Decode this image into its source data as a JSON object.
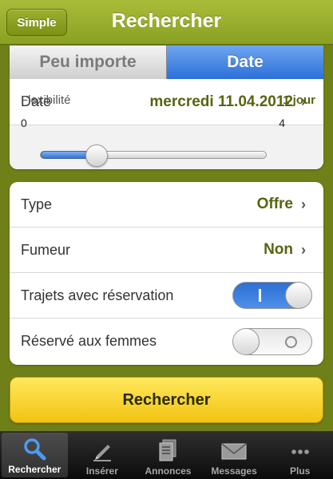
{
  "header": {
    "simple_label": "Simple",
    "title": "Rechercher"
  },
  "segment": {
    "options": [
      "Peu importe",
      "Date"
    ],
    "selected": "Date"
  },
  "date_row": {
    "label": "Date",
    "value": "mercredi 11.04.2012"
  },
  "flexibility": {
    "label": "Flexibilité",
    "value_text": "1 jour",
    "min_label": "0",
    "max_label": "4",
    "min": 0,
    "max": 4,
    "value": 1
  },
  "options": {
    "type": {
      "label": "Type",
      "value": "Offre"
    },
    "smoker": {
      "label": "Fumeur",
      "value": "Non"
    },
    "reservation": {
      "label": "Trajets avec réservation",
      "on": true
    },
    "women": {
      "label": "Réservé aux femmes",
      "on": false
    }
  },
  "search_button": {
    "label": "Rechercher"
  },
  "tabbar": {
    "tabs": [
      {
        "label": "Rechercher",
        "icon": "search-icon",
        "active": true
      },
      {
        "label": "Insérer",
        "icon": "pencil-icon",
        "active": false
      },
      {
        "label": "Annonces",
        "icon": "documents-icon",
        "active": false
      },
      {
        "label": "Messages",
        "icon": "envelope-icon",
        "active": false
      },
      {
        "label": "Plus",
        "icon": "more-icon",
        "active": false
      }
    ]
  }
}
